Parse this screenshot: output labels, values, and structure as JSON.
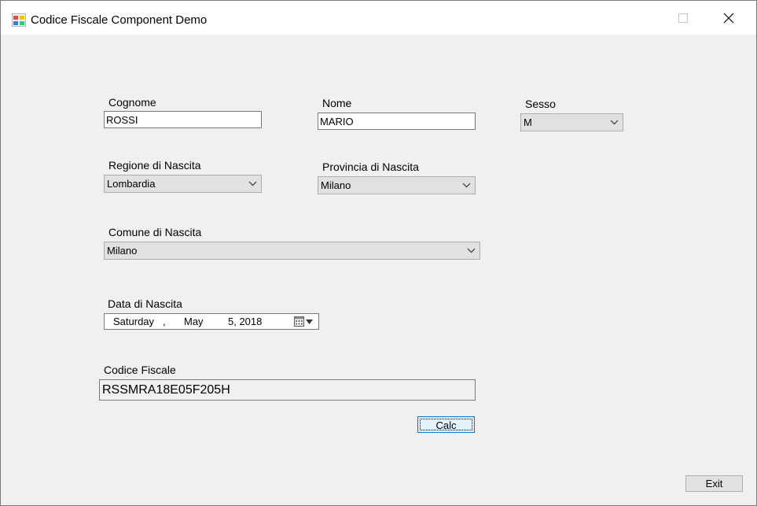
{
  "window": {
    "title": "Codice Fiscale Component Demo"
  },
  "form": {
    "cognome_label": "Cognome",
    "cognome_value": "ROSSI",
    "nome_label": "Nome",
    "nome_value": "MARIO",
    "sesso_label": "Sesso",
    "sesso_value": "M",
    "regione_label": "Regione di Nascita",
    "regione_value": "Lombardia",
    "provincia_label": "Provincia di Nascita",
    "provincia_value": "Milano",
    "comune_label": "Comune di Nascita",
    "comune_value": "Milano",
    "data_label": "Data di Nascita",
    "data_weekday": "Saturday",
    "data_sep": ",",
    "data_month": "May",
    "data_day_year": "5, 2018",
    "codice_label": "Codice Fiscale",
    "codice_value": "RSSMRA18E05F205H"
  },
  "buttons": {
    "calc_label": "Calc",
    "exit_label": "Exit"
  },
  "colors": {
    "focus_border": "#0078d7",
    "window_bg": "#f0f0f0",
    "combo_bg": "#e1e1e1"
  }
}
